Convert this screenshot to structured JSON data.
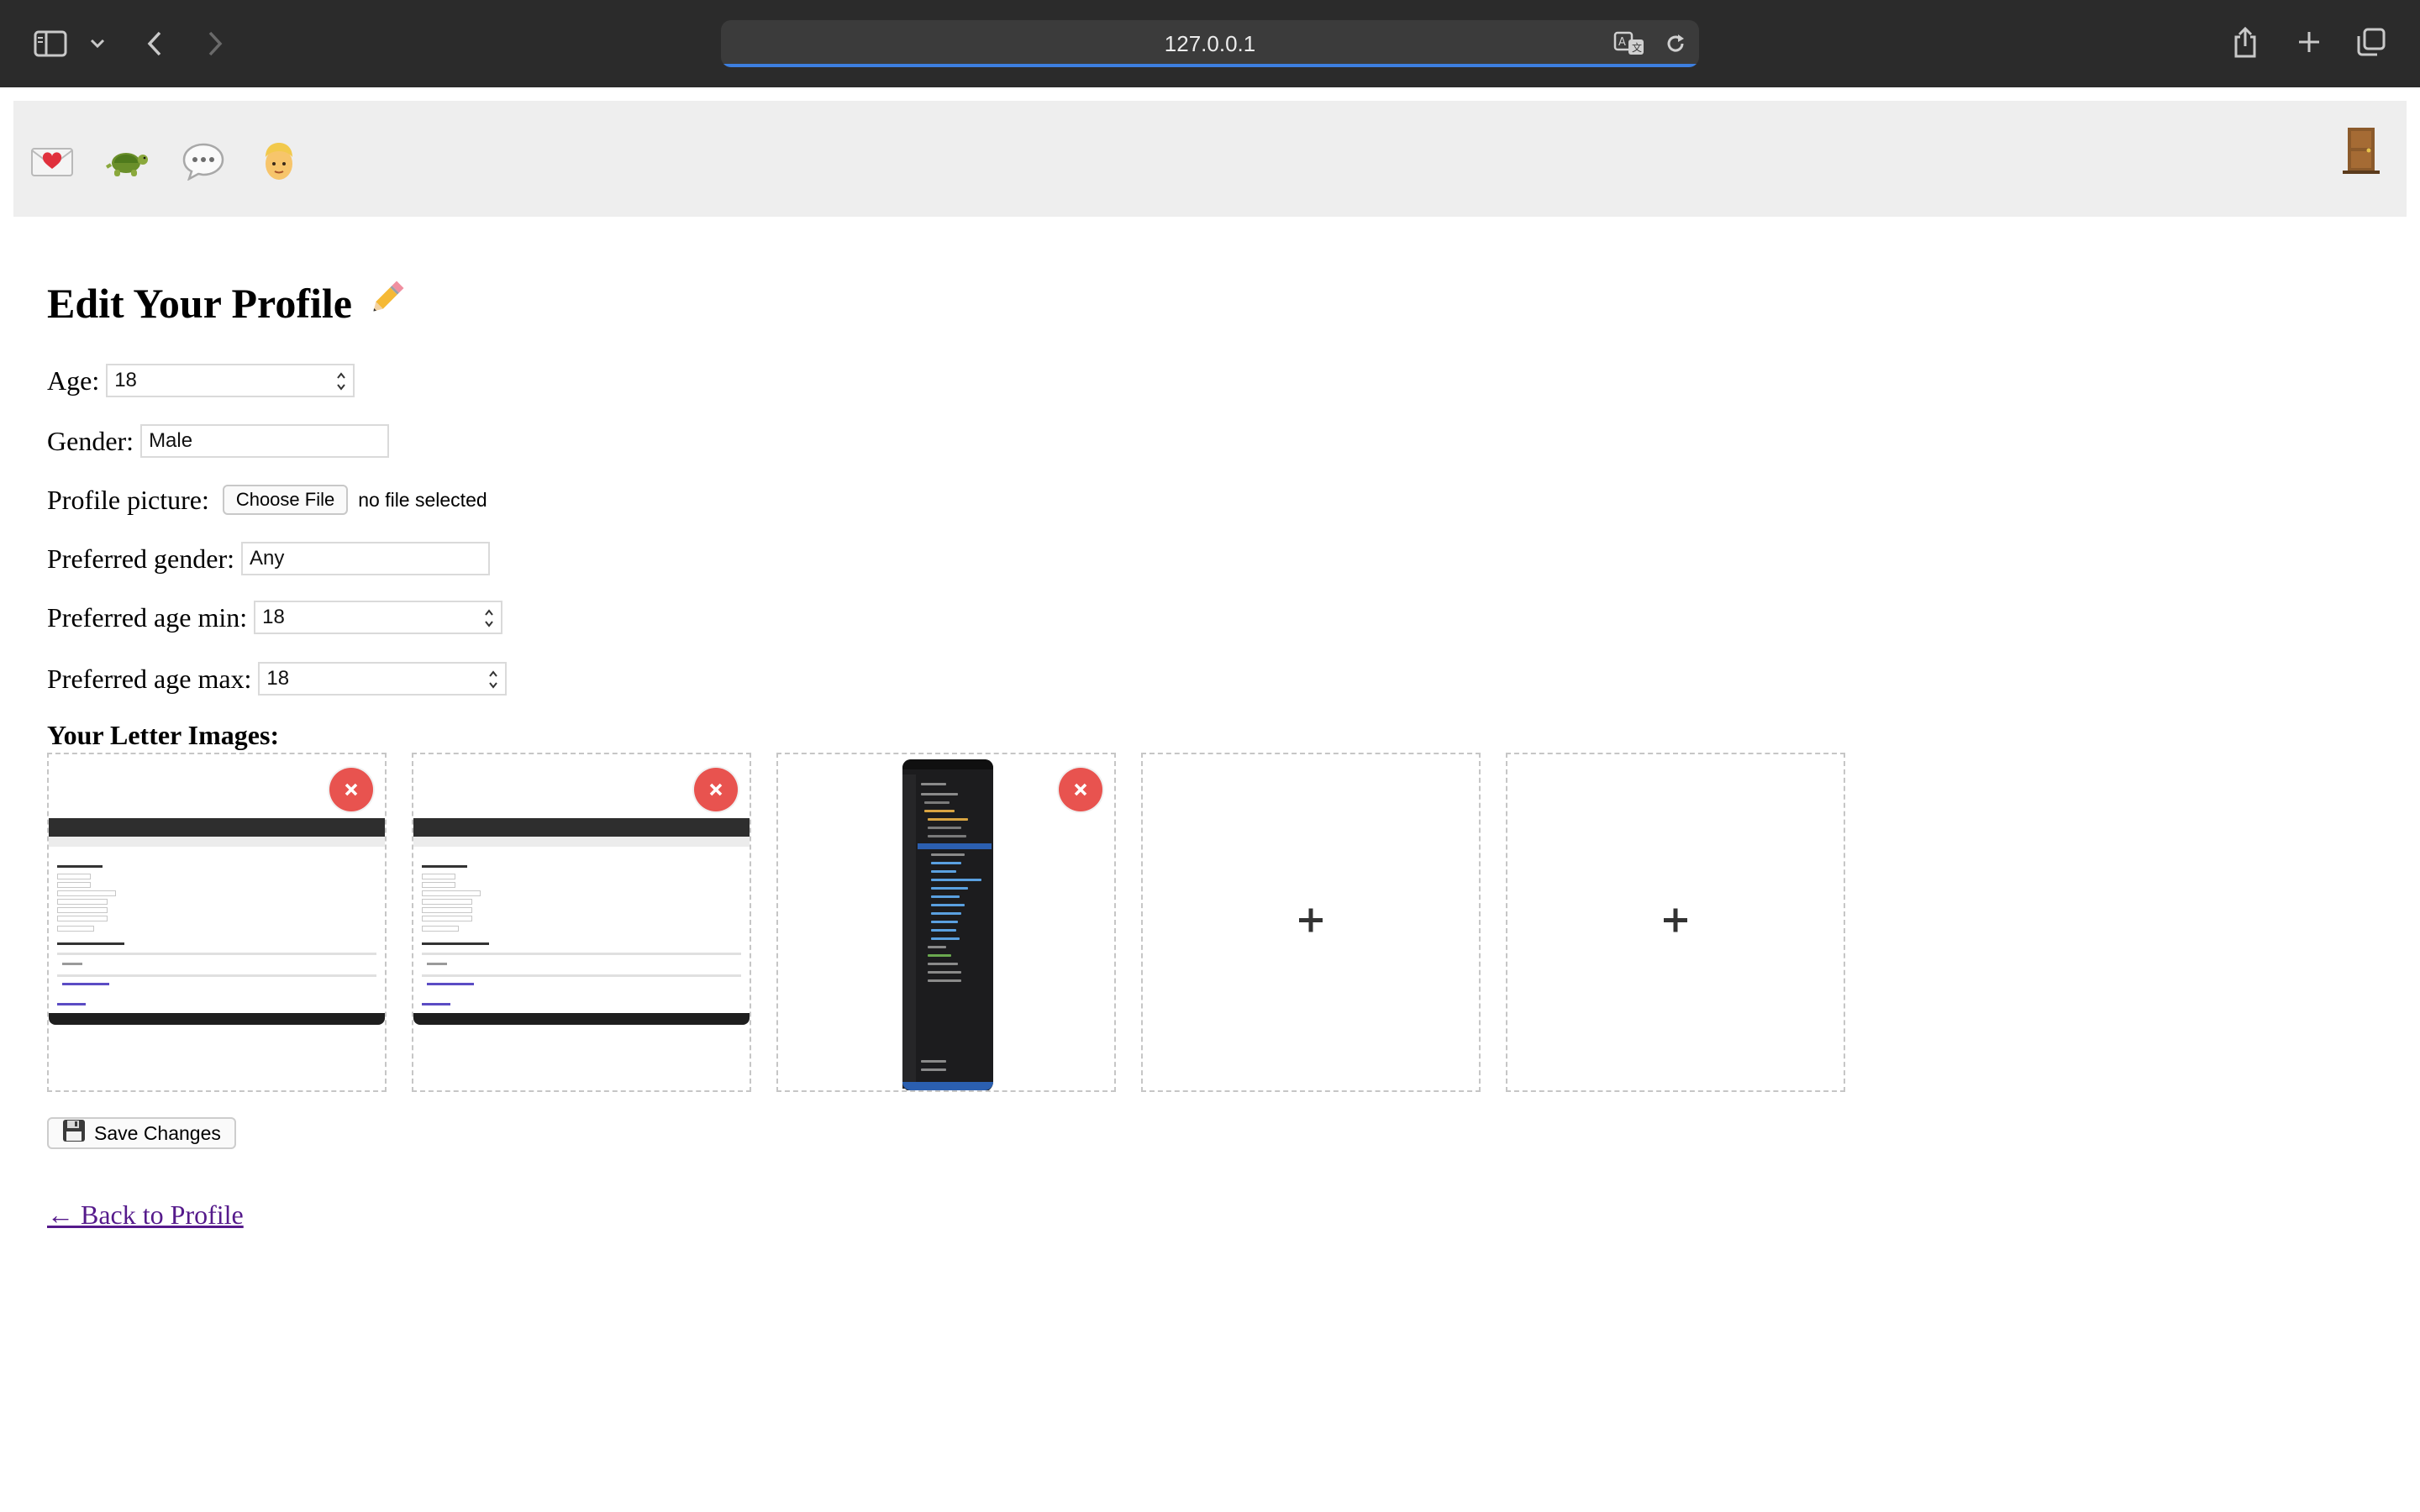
{
  "browser": {
    "url": "127.0.0.1"
  },
  "navbar": {
    "icons": [
      "love-letter-icon",
      "turtle-icon",
      "speech-bubble-icon",
      "person-icon"
    ],
    "logout_icon": "door-icon"
  },
  "page": {
    "title": "Edit Your Profile",
    "title_icon": "pencil-icon"
  },
  "form": {
    "age_label": "Age:",
    "age_value": "18",
    "gender_label": "Gender:",
    "gender_value": "Male",
    "profile_picture_label": "Profile picture:",
    "choose_file_label": "Choose File",
    "file_status": "no file selected",
    "preferred_gender_label": "Preferred gender:",
    "preferred_gender_value": "Any",
    "preferred_age_min_label": "Preferred age min:",
    "preferred_age_min_value": "18",
    "preferred_age_max_label": "Preferred age max:",
    "preferred_age_max_value": "18"
  },
  "letter_images": {
    "title": "Your Letter Images:",
    "slots": [
      {
        "state": "filled",
        "content": "profile-page-screenshot"
      },
      {
        "state": "filled",
        "content": "profile-page-screenshot"
      },
      {
        "state": "filled",
        "content": "code-editor-screenshot"
      },
      {
        "state": "empty"
      },
      {
        "state": "empty"
      }
    ]
  },
  "actions": {
    "save_label": "Save Changes",
    "back_label": "← Back to Profile"
  },
  "colors": {
    "remove_button": "#e8534f",
    "link": "#551a8b",
    "navbar_bg": "#eeeeee",
    "chrome_bg": "#2b2b2b"
  }
}
